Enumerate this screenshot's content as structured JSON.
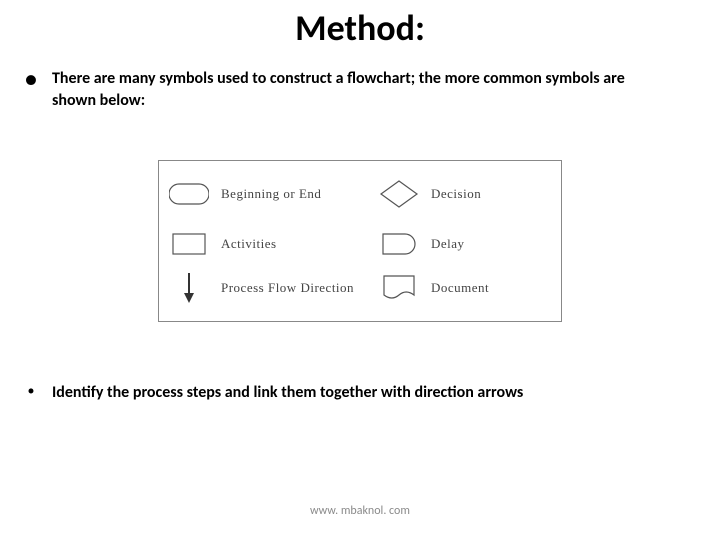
{
  "title": "Method:",
  "bullets": [
    "There are many symbols used to construct a flowchart; the more common symbols are shown below:",
    "Identify the process steps and link them together with direction arrows"
  ],
  "legend": {
    "left": [
      "Beginning or End",
      "Activities",
      "Process Flow Direction"
    ],
    "right": [
      "Decision",
      "Delay",
      "Document"
    ]
  },
  "footer": "www. mbaknol. com"
}
